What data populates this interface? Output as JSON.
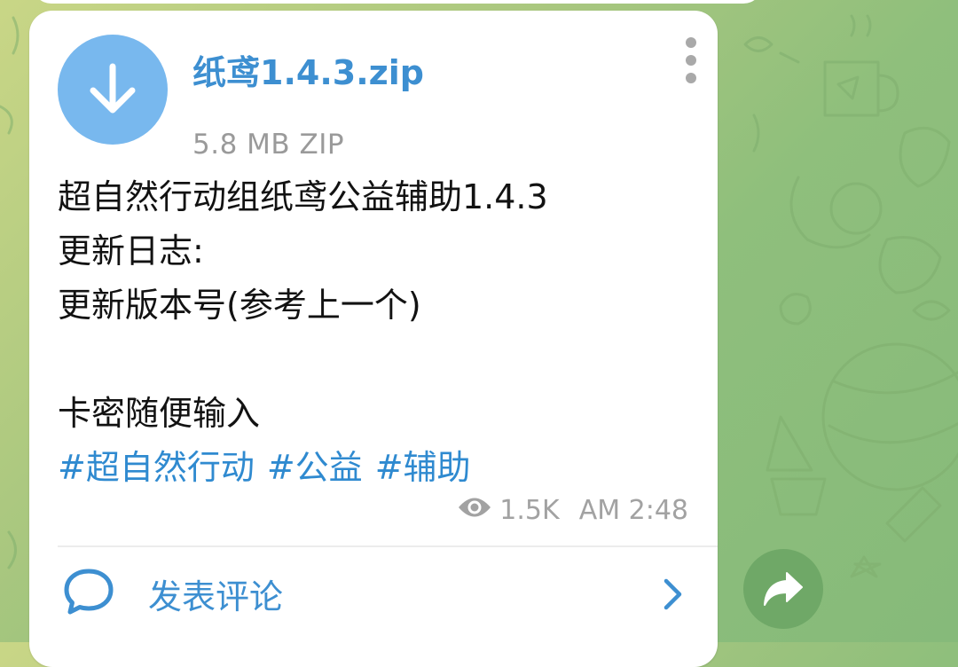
{
  "file": {
    "name": "纸鸢1.4.3.zip",
    "meta": "5.8 MB ZIP",
    "icon": "download-arrow-icon"
  },
  "message": {
    "lines": [
      "超自然行动组纸鸢公益辅助1.4.3",
      "更新日志:",
      "更新版本号(参考上一个)",
      "",
      "卡密随便输入"
    ],
    "hashtags": [
      "#超自然行动",
      "#公益",
      "#辅助"
    ]
  },
  "meta": {
    "views": "1.5K",
    "time": "AM 2:48"
  },
  "comments": {
    "label": "发表评论"
  },
  "colors": {
    "accent": "#3d8fd1",
    "download_circle": "#78b8ee",
    "share_button": "#6fa867",
    "bubble": "#ffffff"
  }
}
